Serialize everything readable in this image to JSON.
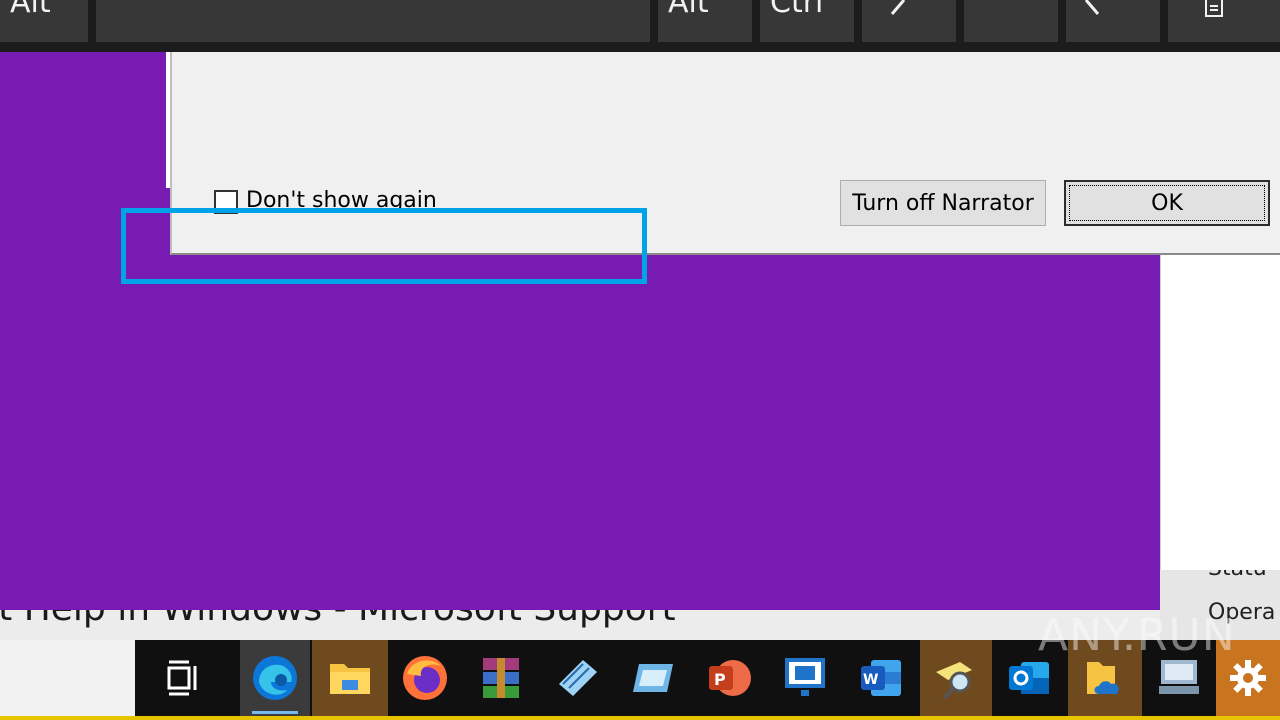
{
  "keyboard": {
    "keys": [
      {
        "label": "Alt"
      },
      {
        "label": ""
      },
      {
        "label": "Alt"
      },
      {
        "label": "Ctrl"
      },
      {
        "label": ""
      },
      {
        "label": ""
      },
      {
        "label": ""
      },
      {
        "label": ""
      }
    ]
  },
  "dialog": {
    "checkbox_label": "Don't show again",
    "checkbox_checked": false,
    "turn_off_label": "Turn off Narrator",
    "ok_label": "OK"
  },
  "background": {
    "bottom_text": "et Help in Windows - Microsoft Support",
    "right_text_1": "Statu",
    "right_text_2": "Opera"
  },
  "taskbar": {
    "items": [
      {
        "name": "task-view-icon"
      },
      {
        "name": "edge-icon"
      },
      {
        "name": "file-explorer-icon"
      },
      {
        "name": "firefox-icon"
      },
      {
        "name": "winrar-icon"
      },
      {
        "name": "notepad-icon"
      },
      {
        "name": "remote-app-icon"
      },
      {
        "name": "powerpoint-icon"
      },
      {
        "name": "network-icon"
      },
      {
        "name": "word-icon"
      },
      {
        "name": "search-tool-icon"
      },
      {
        "name": "outlook-icon"
      },
      {
        "name": "onedrive-folder-icon"
      },
      {
        "name": "computer-icon"
      },
      {
        "name": "settings-icon"
      }
    ]
  },
  "watermark": "ANY.RUN",
  "colors": {
    "purple": "#781BB2",
    "focus": "#00A2E8",
    "taskbar": "#101010"
  }
}
